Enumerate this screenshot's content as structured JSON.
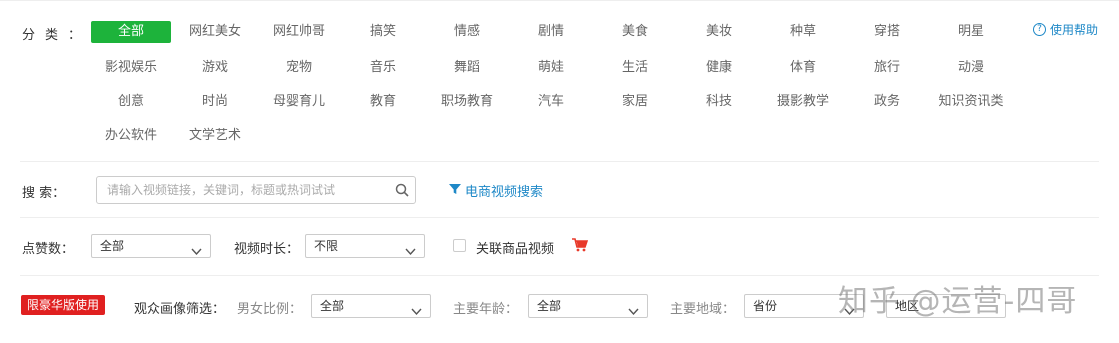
{
  "category": {
    "label": "分类",
    "colon": "：",
    "items": [
      "全部",
      "网红美女",
      "网红帅哥",
      "搞笑",
      "情感",
      "剧情",
      "美食",
      "美妆",
      "种草",
      "穿搭",
      "明星",
      "影视娱乐",
      "游戏",
      "宠物",
      "音乐",
      "舞蹈",
      "萌娃",
      "生活",
      "健康",
      "体育",
      "旅行",
      "动漫",
      "创意",
      "时尚",
      "母婴育儿",
      "教育",
      "职场教育",
      "汽车",
      "家居",
      "科技",
      "摄影教学",
      "政务",
      "知识资讯类",
      "办公软件",
      "文学艺术"
    ],
    "active_index": 0
  },
  "help_label": "使用帮助",
  "search": {
    "label": "搜 索：",
    "placeholder": "请输入视频链接，关键词，标题或热词试试",
    "ecommerce_link": "电商视频搜索"
  },
  "filters": {
    "likes_label": "点赞数：",
    "likes_value": "全部",
    "duration_label": "视频时长：",
    "duration_value": "不限",
    "related_goods_label": "关联商品视频"
  },
  "audience": {
    "badge": "限豪华版使用",
    "title": "观众画像筛选：",
    "gender_label": "男女比例：",
    "gender_value": "全部",
    "age_label": "主要年龄：",
    "age_value": "全部",
    "region_label": "主要地域：",
    "province_value": "省份",
    "area_value": "地区"
  },
  "watermark": "知乎 @运营-四哥",
  "colors": {
    "accent": "#1db33b",
    "link": "#1e88c7",
    "badge": "#e02020",
    "cart": "#e8392a"
  }
}
